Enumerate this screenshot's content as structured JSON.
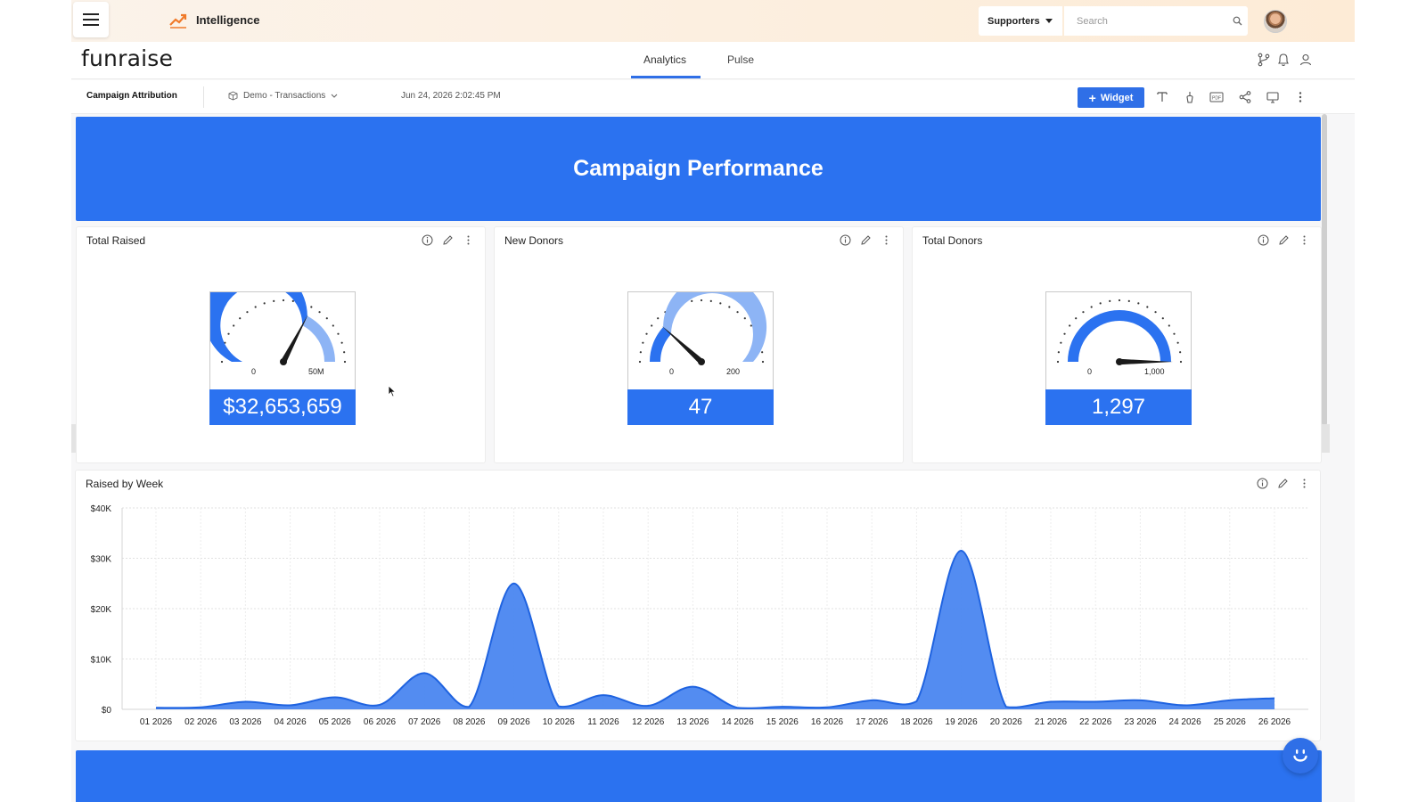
{
  "app": {
    "title": "Intelligence",
    "brand": "funraise"
  },
  "topbar": {
    "selector_label": "Supporters",
    "search_placeholder": "Search"
  },
  "tabs": [
    {
      "label": "Analytics",
      "active": true
    },
    {
      "label": "Pulse",
      "active": false
    }
  ],
  "toolbar": {
    "dashboard_name": "Campaign Attribution",
    "data_model": "Demo - Transactions",
    "timestamp": "Jun 24, 2026 2:02:45 PM",
    "widget_button": "Widget"
  },
  "banner": {
    "title": "Campaign Performance"
  },
  "gauges": [
    {
      "title": "Total Raised",
      "min_label": "0",
      "max_label": "50M",
      "min": 0,
      "max": 50000000,
      "value": 32653659,
      "value_label": "$32,653,659"
    },
    {
      "title": "New Donors",
      "min_label": "0",
      "max_label": "200",
      "min": 0,
      "max": 200,
      "value": 47,
      "value_label": "47"
    },
    {
      "title": "Total Donors",
      "min_label": "0",
      "max_label": "1,000",
      "min": 0,
      "max": 1000,
      "value": 1297,
      "value_label": "1,297"
    }
  ],
  "colors": {
    "primary": "#2b72f0",
    "accent_light": "#8db4f5",
    "topbar": "#fdebd6"
  },
  "chart_data": {
    "type": "area",
    "title": "Raised by Week",
    "categories": [
      "01 2026",
      "02 2026",
      "03 2026",
      "04 2026",
      "05 2026",
      "06 2026",
      "07 2026",
      "08 2026",
      "09 2026",
      "10 2026",
      "11 2026",
      "12 2026",
      "13 2026",
      "14 2026",
      "15 2026",
      "16 2026",
      "17 2026",
      "18 2026",
      "19 2026",
      "20 2026",
      "21 2026",
      "22 2026",
      "23 2026",
      "24 2026",
      "25 2026",
      "26 2026"
    ],
    "series": [
      {
        "values": [
          300,
          400,
          1500,
          800,
          2400,
          900,
          7200,
          500,
          25000,
          600,
          2800,
          700,
          4500,
          300,
          500,
          400,
          1800,
          1600,
          31500,
          500,
          1500,
          1500,
          1800,
          800,
          1800,
          2200
        ]
      }
    ],
    "yticks": [
      "$0",
      "$10K",
      "$20K",
      "$30K",
      "$40K"
    ],
    "ylim": [
      0,
      40000
    ],
    "grid": true
  }
}
